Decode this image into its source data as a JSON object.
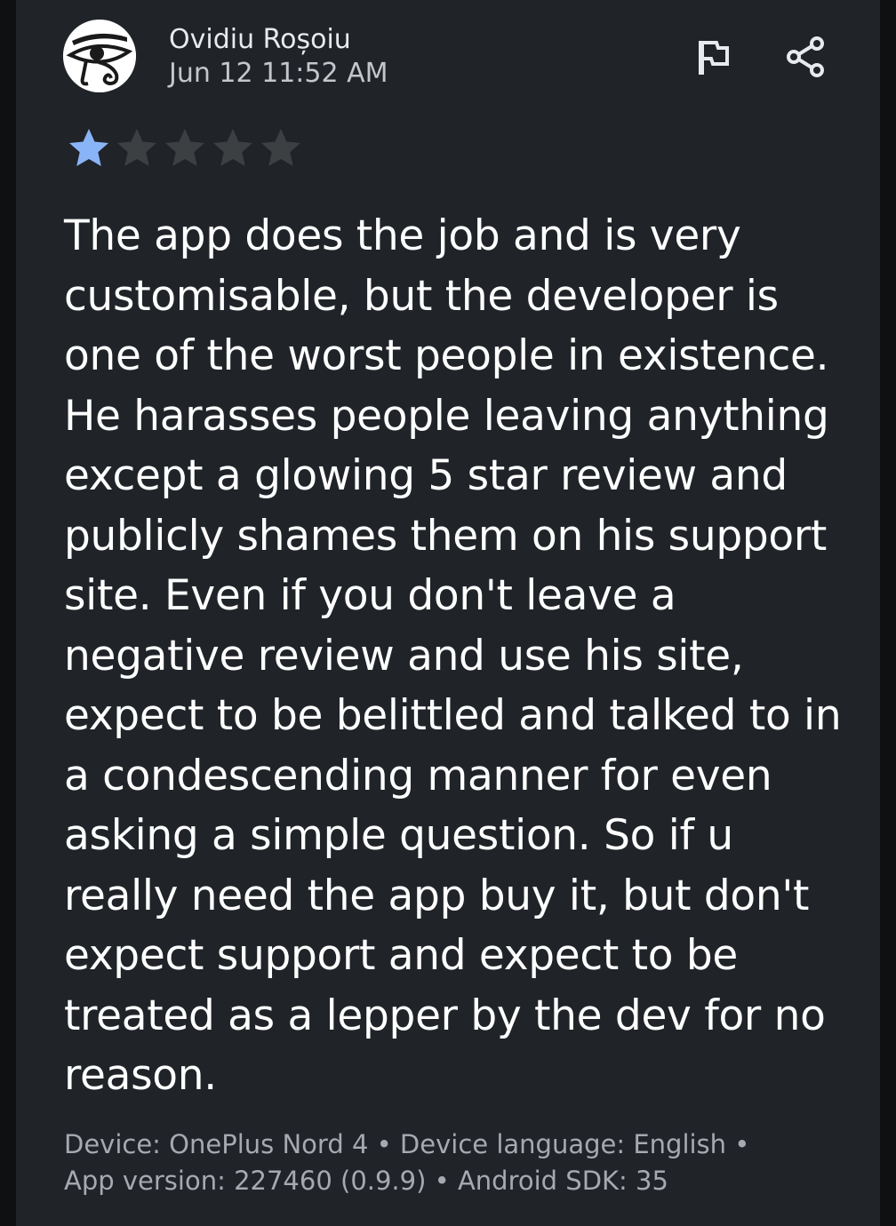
{
  "review": {
    "author": "Ovidiu Roșoiu",
    "timestamp": "Jun 12 11:52 AM",
    "avatar_icon": "eye-of-horus-icon",
    "rating": 1,
    "rating_max": 5,
    "star_filled_color": "#8ab4f8",
    "star_empty_color": "#3c4043",
    "text": "The app does the job and is very customisable, but the developer is one of the worst people in existence. He harasses people leaving anything except a glowing 5 star review and publicly shames them on his support site. Even if you don't leave a negative review and use his site, expect to be belittled and talked to in a condescending manner for even asking a simple question. So if u really need the app buy it, but don't expect support and expect to be treated as a lepper by the dev for no reason.",
    "meta_line_1": "Device: OnePlus Nord 4 • Device language: English •",
    "meta_line_2": "App version: 227460 (0.9.9) • Android SDK: 35"
  },
  "actions": {
    "flag_icon": "flag-icon",
    "share_icon": "share-icon"
  }
}
